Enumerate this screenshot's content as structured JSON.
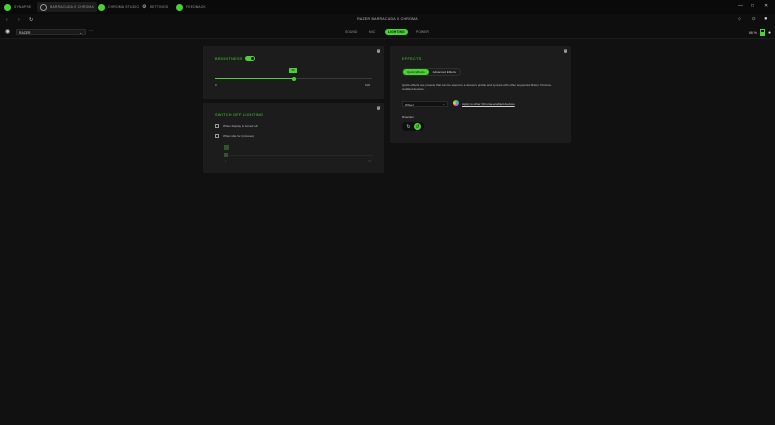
{
  "tabs": [
    {
      "label": "SYNAPSE",
      "active": false
    },
    {
      "label": "BARRACUDA X CHROMA",
      "active": true
    },
    {
      "label": "CHROMA STUDIO",
      "active": false
    },
    {
      "label": "SETTINGS",
      "active": false
    },
    {
      "label": "FEEDBACK",
      "active": false
    }
  ],
  "window_controls": {
    "min": "—",
    "max": "□",
    "close": "✕"
  },
  "device_title": "RAZER BARRACUDA X CHROMA",
  "profile": {
    "value": "RAZER",
    "more": "···"
  },
  "nav_tabs": [
    {
      "label": "SOUND",
      "active": false
    },
    {
      "label": "MIC",
      "active": false
    },
    {
      "label": "LIGHTING",
      "active": true
    },
    {
      "label": "POWER",
      "active": false
    }
  ],
  "battery_percent": "98 %",
  "brightness": {
    "title": "BRIGHTNESS",
    "enabled": true,
    "value": "50",
    "min": "0",
    "max": "100",
    "level": 0.5
  },
  "switch_off": {
    "title": "SWITCH OFF LIGHTING",
    "options": [
      {
        "label": "When display is turned off",
        "checked": false
      },
      {
        "label": "When idle for (minutes)",
        "checked": false
      }
    ],
    "slider_min": "1",
    "slider_max": "15"
  },
  "effects": {
    "title": "EFFECTS",
    "tabs": [
      {
        "label": "Quick Effects",
        "active": true
      },
      {
        "label": "Advanced Effects",
        "active": false
      }
    ],
    "description": "Quick effects are presets that can be saved to a device's profile and synced with other supported Razer Chroma-enabled devices.",
    "selected_effect": "Wheel",
    "apply_link": "Apply to other Chroma-enabled devices",
    "direction_label": "Direction"
  },
  "colors": {
    "accent": "#44d62c",
    "background": "#111111",
    "panel": "#1c1c1c"
  }
}
